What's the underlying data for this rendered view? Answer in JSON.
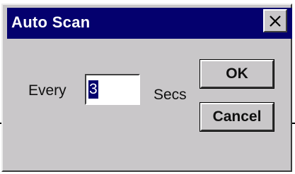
{
  "dialog": {
    "title": "Auto Scan",
    "close_icon": "close-icon",
    "interval_label": "Every",
    "interval_value": "3",
    "unit_label": "Secs",
    "ok_label": "OK",
    "cancel_label": "Cancel"
  },
  "colors": {
    "titlebar": "#04006e",
    "dialog_face": "#c9c7c9",
    "selection": "#04006e"
  }
}
